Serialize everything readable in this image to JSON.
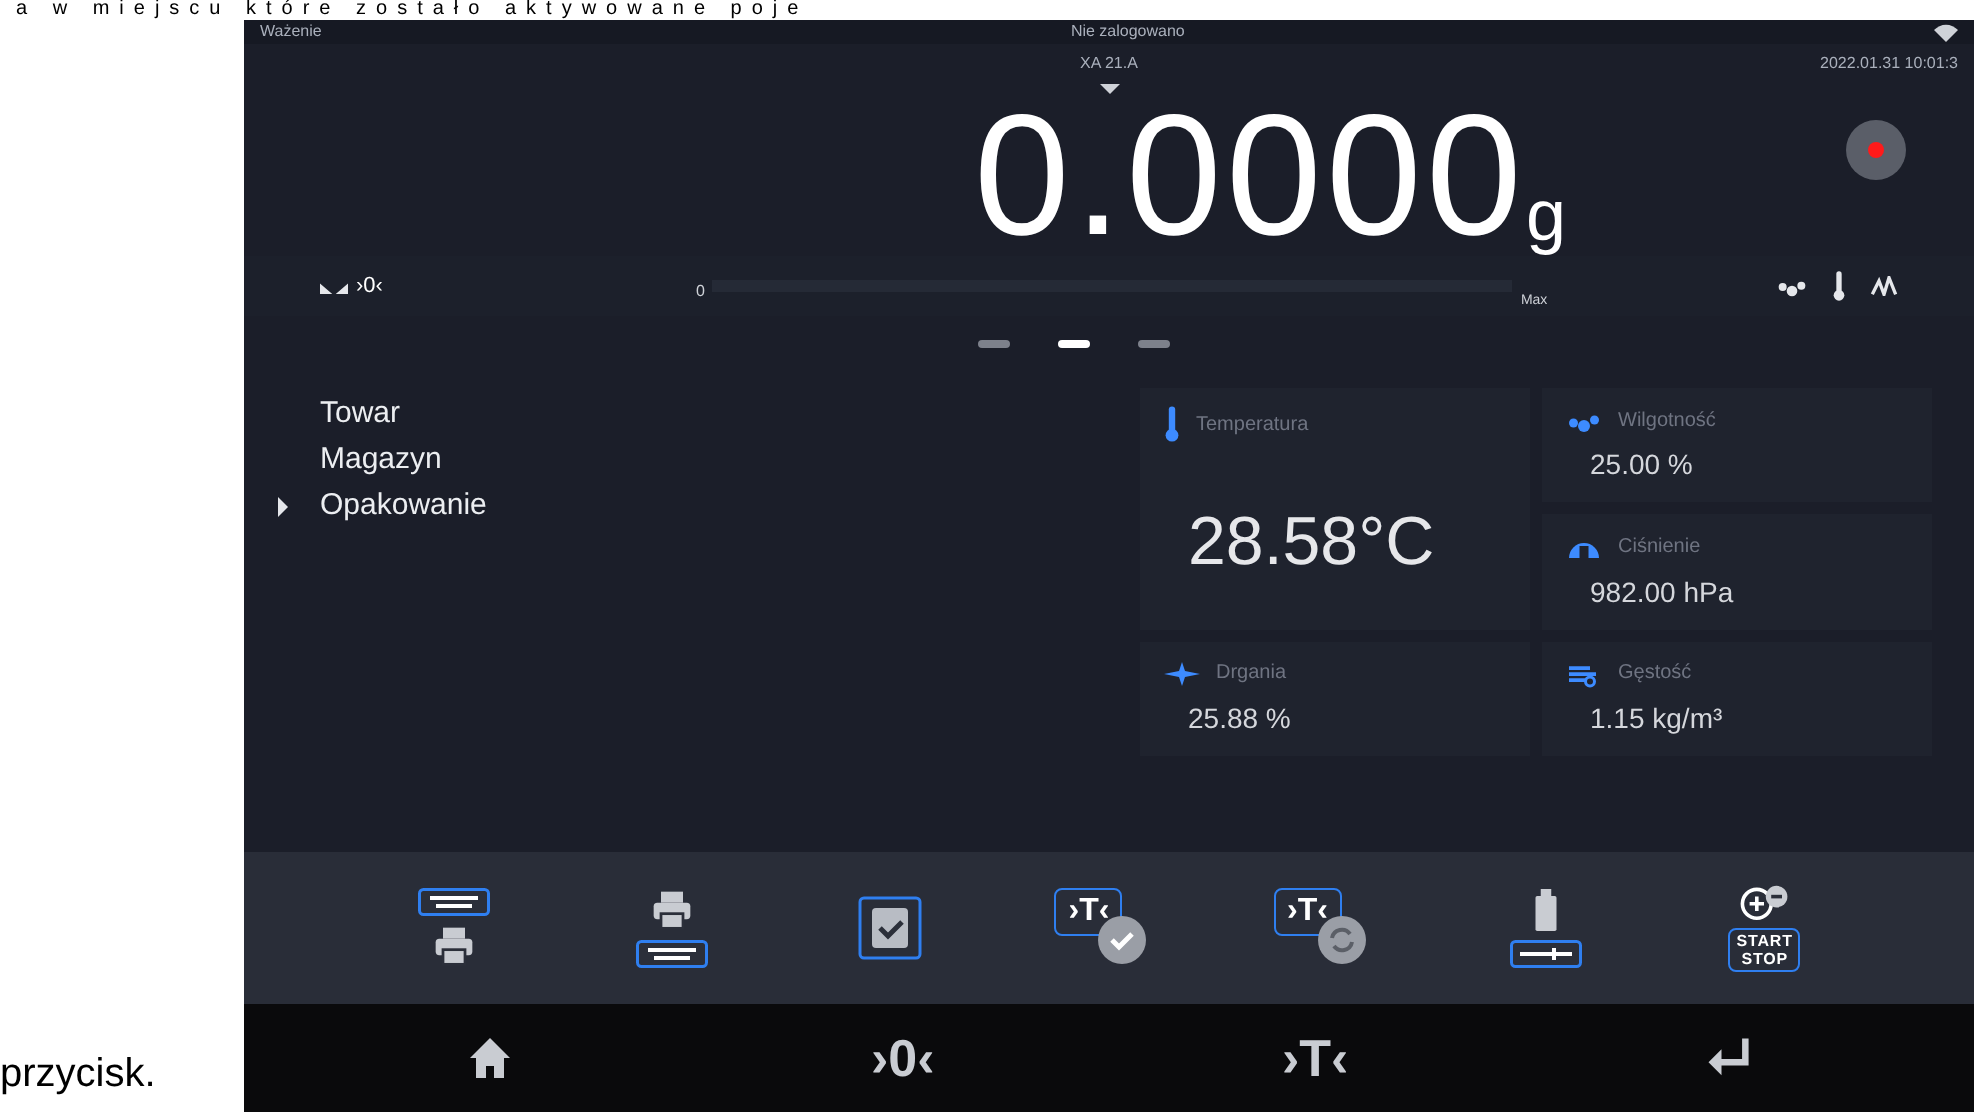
{
  "document": {
    "top_text": "a w miejscu które zostało aktywowane poje",
    "side_text": "przycisk."
  },
  "header": {
    "mode": "Ważenie",
    "user": "Nie zalogowano",
    "device": "XA 21.A",
    "datetime": "2022.01.31 10:01:3"
  },
  "weight": {
    "value": "0.0000",
    "unit": "g",
    "zero_indicator": "›0‹",
    "bar_min": "0",
    "bar_max": "Max"
  },
  "pager": [
    {
      "selected": false
    },
    {
      "selected": true
    },
    {
      "selected": false
    }
  ],
  "menu": [
    {
      "label": "Towar",
      "selected": false
    },
    {
      "label": "Magazyn",
      "selected": false
    },
    {
      "label": "Opakowanie",
      "selected": true
    }
  ],
  "tiles": [
    {
      "kind": "large",
      "label": "Temperatura",
      "value": "28.58°C"
    },
    {
      "kind": "small",
      "label": "Wilgotność",
      "value": "25.00 %"
    },
    {
      "kind": "small",
      "label": "Ciśnienie",
      "value": "982.00 hPa"
    },
    {
      "kind": "small",
      "label": "Drgania",
      "value": "25.88 %"
    },
    {
      "kind": "small",
      "label": "Gęstość",
      "value": "1.15 kg/m³"
    }
  ],
  "toolbar": [
    {
      "kind": "print-header"
    },
    {
      "kind": "print-footer"
    },
    {
      "kind": "save"
    },
    {
      "kind": "tare-check",
      "text": "›T‹"
    },
    {
      "kind": "tare-auto",
      "text": "›T‹"
    },
    {
      "kind": "weight"
    },
    {
      "kind": "start-stop",
      "text": "START STOP"
    }
  ],
  "nav": [
    {
      "kind": "home"
    },
    {
      "kind": "text",
      "text": "›0‹"
    },
    {
      "kind": "text",
      "text": "›T‹"
    },
    {
      "kind": "enter"
    }
  ]
}
